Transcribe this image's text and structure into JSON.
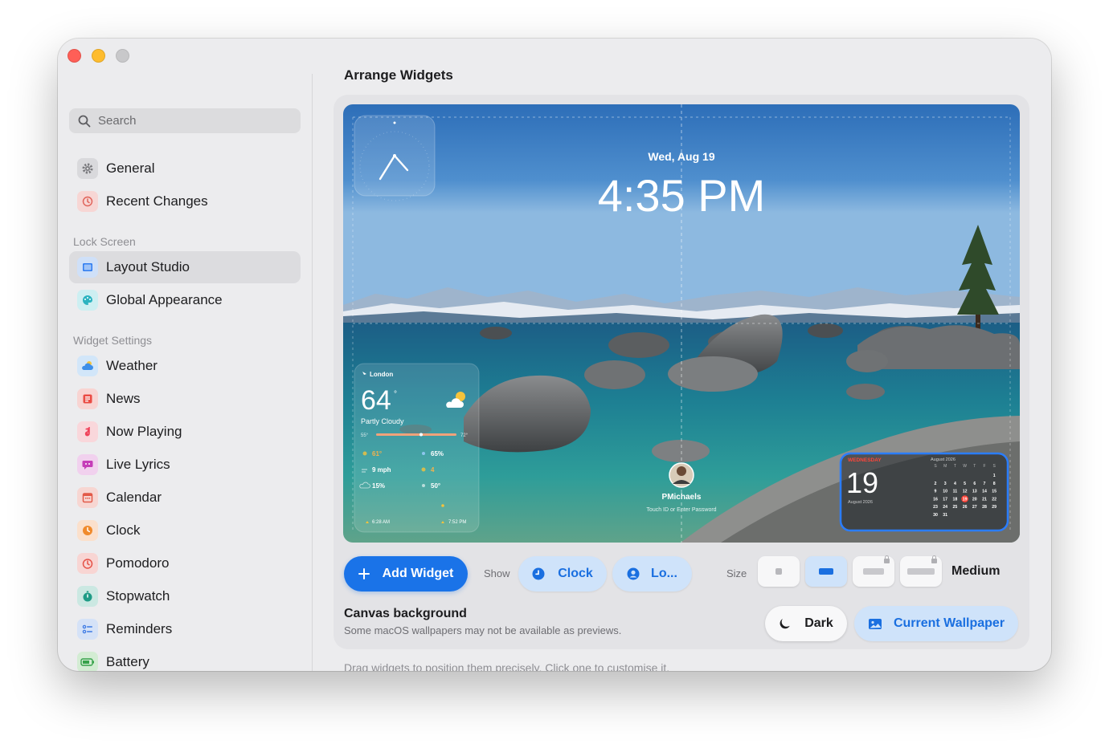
{
  "sidebar": {
    "search_placeholder": "Search",
    "items_top": [
      {
        "label": "General",
        "icon": "gear-icon"
      },
      {
        "label": "Recent Changes",
        "icon": "history-icon"
      }
    ],
    "section_lock": "Lock Screen",
    "items_lock": [
      {
        "label": "Layout Studio",
        "icon": "layout-icon",
        "selected": true
      },
      {
        "label": "Global Appearance",
        "icon": "palette-icon"
      }
    ],
    "section_widgets": "Widget Settings",
    "items_widgets": [
      {
        "label": "Weather",
        "icon": "weather-icon"
      },
      {
        "label": "News",
        "icon": "news-icon"
      },
      {
        "label": "Now Playing",
        "icon": "music-note-icon"
      },
      {
        "label": "Live Lyrics",
        "icon": "lyrics-icon"
      },
      {
        "label": "Calendar",
        "icon": "calendar-icon"
      },
      {
        "label": "Clock",
        "icon": "clock-icon"
      },
      {
        "label": "Pomodoro",
        "icon": "timer-icon"
      },
      {
        "label": "Stopwatch",
        "icon": "stopwatch-icon"
      },
      {
        "label": "Reminders",
        "icon": "checklist-icon"
      },
      {
        "label": "Battery",
        "icon": "battery-icon"
      }
    ]
  },
  "main": {
    "title": "Arrange Widgets",
    "preview": {
      "date": "Wed, Aug 19",
      "time": "4:35 PM",
      "user_name": "PMichaels",
      "user_hint": "Touch ID or Enter Password",
      "weather": {
        "city": "London",
        "temp": "64",
        "deg": "°",
        "condition": "Partly Cloudy",
        "low": "55°",
        "high": "72°",
        "feels": "61°",
        "humidity": "65%",
        "wind": "9 mph",
        "uv": "4",
        "precip": "15%",
        "extra": "50°",
        "sunrise": "6:28 AM",
        "sunset": "7:52 PM"
      },
      "calendar": {
        "weekday": "WEDNESDAY",
        "day": "19",
        "month_small": "August 2026",
        "month_title": "August 2026",
        "dow": [
          "S",
          "M",
          "T",
          "W",
          "T",
          "F",
          "S"
        ],
        "rows": [
          [
            "",
            "",
            "",
            "",
            "",
            "",
            "1"
          ],
          [
            "2",
            "3",
            "4",
            "5",
            "6",
            "7",
            "8"
          ],
          [
            "9",
            "10",
            "11",
            "12",
            "13",
            "14",
            "15"
          ],
          [
            "16",
            "17",
            "18",
            "19",
            "20",
            "21",
            "22"
          ],
          [
            "23",
            "24",
            "25",
            "26",
            "27",
            "28",
            "29"
          ],
          [
            "30",
            "31",
            "",
            "",
            "",
            "",
            ""
          ]
        ],
        "today": "19"
      }
    },
    "toolbar": {
      "add_label": "Add Widget",
      "show_label": "Show",
      "show_clock": "Clock",
      "show_lo": "Lo...",
      "size_label": "Size",
      "size_value": "Medium"
    },
    "background": {
      "title": "Canvas background",
      "subtitle": "Some macOS wallpapers may not be available as previews.",
      "dark_label": "Dark",
      "wallpaper_label": "Current Wallpaper"
    },
    "footer_note": "Drag widgets to position them precisely. Click one to customise it."
  },
  "colors": {
    "accent": "#1a73e8",
    "accent_soft": "#cfe3fa",
    "today": "#ff453a"
  }
}
